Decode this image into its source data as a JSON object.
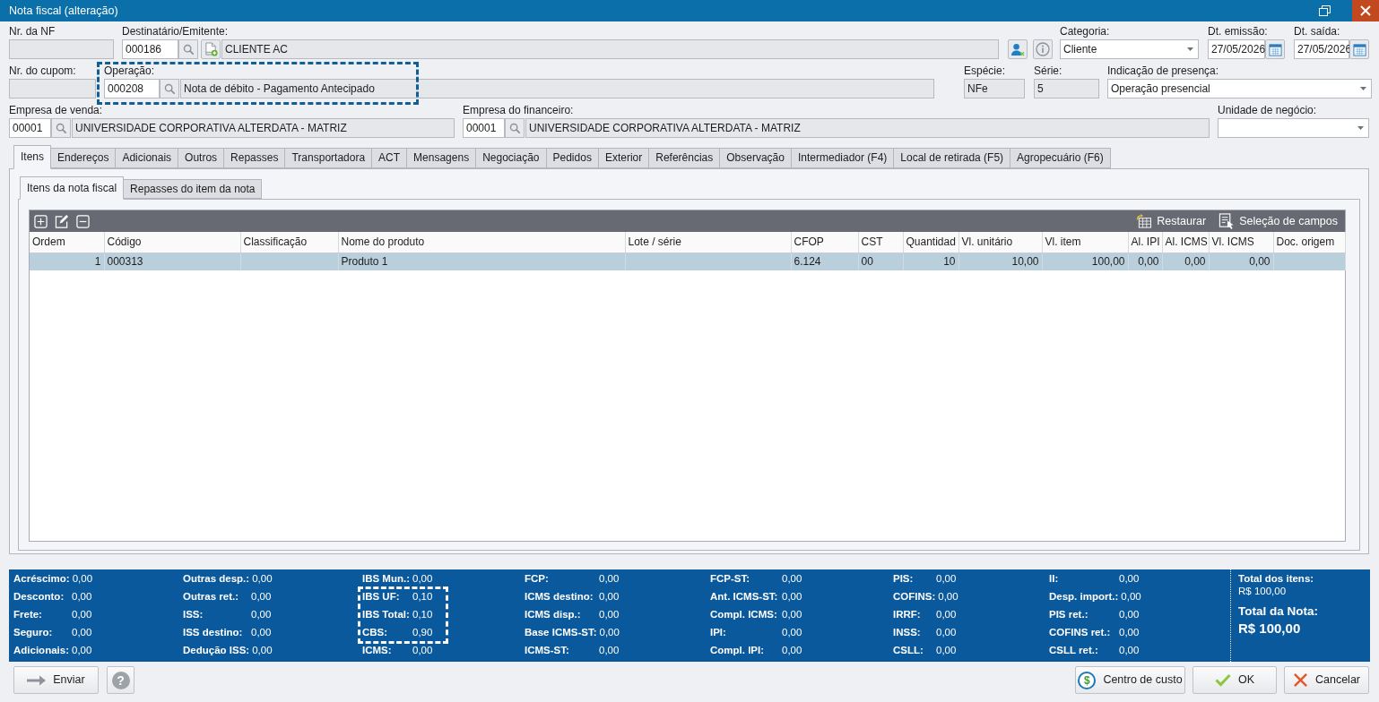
{
  "window": {
    "title": "Nota fiscal (alteração)"
  },
  "header": {
    "nr_nf": {
      "label": "Nr. da NF"
    },
    "destinatario": {
      "label": "Destinatário/Emitente:",
      "code": "000186",
      "name": "CLIENTE AC"
    },
    "categoria": {
      "label": "Categoria:",
      "value": "Cliente"
    },
    "dt_emissao": {
      "label": "Dt. emissão:",
      "value": "27/05/2026"
    },
    "dt_saida": {
      "label": "Dt. saída:",
      "value": "27/05/2026"
    },
    "nr_cupom": {
      "label": "Nr. do cupom:"
    },
    "operacao": {
      "label": "Operação:",
      "code": "000208",
      "name": "Nota de débito - Pagamento Antecipado",
      "highlighted": true
    },
    "especie": {
      "label": "Espécie:",
      "value": "NFe"
    },
    "serie": {
      "label": "Série:",
      "value": "5"
    },
    "indicacao_presenca": {
      "label": "Indicação de presença:",
      "value": "Operação presencial"
    },
    "empresa_venda": {
      "label": "Empresa de venda:",
      "code": "00001",
      "name": "UNIVERSIDADE CORPORATIVA ALTERDATA - MATRIZ"
    },
    "empresa_financeiro": {
      "label": "Empresa do financeiro:",
      "code": "00001",
      "name": "UNIVERSIDADE CORPORATIVA ALTERDATA - MATRIZ"
    },
    "unidade_negocio": {
      "label": "Unidade de negócio:"
    }
  },
  "tabs": [
    {
      "label": "Itens",
      "selected": true
    },
    {
      "label": "Endereços",
      "selected": false
    },
    {
      "label": "Adicionais",
      "selected": false
    },
    {
      "label": "Outros",
      "selected": false
    },
    {
      "label": "Repasses",
      "selected": false
    },
    {
      "label": "Transportadora",
      "selected": false
    },
    {
      "label": "ACT",
      "selected": false
    },
    {
      "label": "Mensagens",
      "selected": false
    },
    {
      "label": "Negociação",
      "selected": false
    },
    {
      "label": "Pedidos",
      "selected": false
    },
    {
      "label": "Exterior",
      "selected": false
    },
    {
      "label": "Referências",
      "selected": false
    },
    {
      "label": "Observação",
      "selected": false
    },
    {
      "label": "Intermediador (F4)",
      "selected": false
    },
    {
      "label": "Local de retirada (F5)",
      "selected": false
    },
    {
      "label": "Agropecuário (F6)",
      "selected": false
    }
  ],
  "subtabs": [
    {
      "label": "Itens da nota fiscal",
      "selected": true
    },
    {
      "label": "Repasses do item da nota",
      "selected": false
    }
  ],
  "grid": {
    "tools": [
      {
        "kind": "restore",
        "label": "Restaurar"
      },
      {
        "kind": "fields",
        "label": "Seleção de campos"
      }
    ],
    "columns": [
      {
        "label": "Ordem",
        "kind": "number"
      },
      {
        "label": "Código",
        "kind": "text"
      },
      {
        "label": "Classificação",
        "kind": "text"
      },
      {
        "label": "Nome do produto",
        "kind": "text"
      },
      {
        "label": "Lote / série",
        "kind": "text"
      },
      {
        "label": "CFOP",
        "kind": "text"
      },
      {
        "label": "CST",
        "kind": "text"
      },
      {
        "label": "Quantidad",
        "kind": "number"
      },
      {
        "label": "Vl. unitário",
        "kind": "number"
      },
      {
        "label": "Vl. item",
        "kind": "number"
      },
      {
        "label": "Al. IPI",
        "kind": "number"
      },
      {
        "label": "Al. ICMS",
        "kind": "number"
      },
      {
        "label": "Vl. ICMS",
        "kind": "number"
      },
      {
        "label": "Doc. origem",
        "kind": "text"
      }
    ],
    "rows": [
      {
        "selected": true,
        "cells": [
          "1",
          "000313",
          null,
          "Produto 1",
          null,
          "6.124",
          "00",
          "10",
          "10,00",
          "100,00",
          "0,00",
          "0,00",
          "0,00",
          null
        ]
      }
    ]
  },
  "totals": {
    "columns": [
      {
        "items": [
          {
            "label": "Acréscimo:",
            "value": "0,00",
            "highlighted": false
          },
          {
            "label": "Desconto:",
            "value": "0,00",
            "highlighted": false
          },
          {
            "label": "Frete:",
            "value": "0,00",
            "highlighted": false
          },
          {
            "label": "Seguro:",
            "value": "0,00",
            "highlighted": false
          },
          {
            "label": "Adicionais:",
            "value": "0,00",
            "highlighted": false
          }
        ]
      },
      {
        "items": [
          {
            "label": "Outras desp.:",
            "value": "0,00",
            "highlighted": false
          },
          {
            "label": "Outras ret.:",
            "value": "0,00",
            "highlighted": false
          },
          {
            "label": "ISS:",
            "value": "0,00",
            "highlighted": false
          },
          {
            "label": "ISS destino:",
            "value": "0,00",
            "highlighted": false
          },
          {
            "label": "Dedução ISS:",
            "value": "0,00",
            "highlighted": false
          }
        ]
      },
      {
        "items": [
          {
            "label": "IBS Mun.:",
            "value": "0,00",
            "highlighted": false
          },
          {
            "label": "IBS UF:",
            "value": "0,10",
            "highlighted": true
          },
          {
            "label": "IBS Total:",
            "value": "0,10",
            "highlighted": true
          },
          {
            "label": "CBS:",
            "value": "0,90",
            "highlighted": true
          },
          {
            "label": "ICMS:",
            "value": "0,00",
            "highlighted": false
          }
        ]
      },
      {
        "items": [
          {
            "label": "FCP:",
            "value": "0,00",
            "highlighted": false
          },
          {
            "label": "ICMS destino:",
            "value": "0,00",
            "highlighted": false
          },
          {
            "label": "ICMS disp.:",
            "value": "0,00",
            "highlighted": false
          },
          {
            "label": "Base ICMS-ST:",
            "value": "0,00",
            "highlighted": false
          },
          {
            "label": "ICMS-ST:",
            "value": "0,00",
            "highlighted": false
          }
        ]
      },
      {
        "items": [
          {
            "label": "FCP-ST:",
            "value": "0,00",
            "highlighted": false
          },
          {
            "label": "Ant. ICMS-ST:",
            "value": "0,00",
            "highlighted": false
          },
          {
            "label": "Compl. ICMS:",
            "value": "0,00",
            "highlighted": false
          },
          {
            "label": "IPI:",
            "value": "0,00",
            "highlighted": false
          },
          {
            "label": "Compl. IPI:",
            "value": "0,00",
            "highlighted": false
          }
        ]
      },
      {
        "items": [
          {
            "label": "PIS:",
            "value": "0,00",
            "highlighted": false
          },
          {
            "label": "COFINS:",
            "value": "0,00",
            "highlighted": false
          },
          {
            "label": "IRRF:",
            "value": "0,00",
            "highlighted": false
          },
          {
            "label": "INSS:",
            "value": "0,00",
            "highlighted": false
          },
          {
            "label": "CSLL:",
            "value": "0,00",
            "highlighted": false
          }
        ]
      },
      {
        "items": [
          {
            "label": "II:",
            "value": "0,00",
            "highlighted": false
          },
          {
            "label": "Desp. import.:",
            "value": "0,00",
            "highlighted": false
          },
          {
            "label": "PIS ret.:",
            "value": "0,00",
            "highlighted": false
          },
          {
            "label": "COFINS ret.:",
            "value": "0,00",
            "highlighted": false
          },
          {
            "label": "CSLL ret.:",
            "value": "0,00",
            "highlighted": false
          }
        ]
      }
    ],
    "summary": {
      "items_label": "Total dos itens:",
      "items_value": "R$ 100,00",
      "total_label": "Total da Nota:",
      "total_value": "R$ 100,00"
    }
  },
  "buttons": [
    {
      "kind": "send",
      "label": "Enviar"
    },
    {
      "kind": "help",
      "icon": "?"
    },
    {
      "kind": "cost",
      "icon": "$",
      "label": "Centro de custo"
    },
    {
      "kind": "ok",
      "label": "OK"
    },
    {
      "kind": "cancel",
      "label": "Cancelar"
    }
  ]
}
